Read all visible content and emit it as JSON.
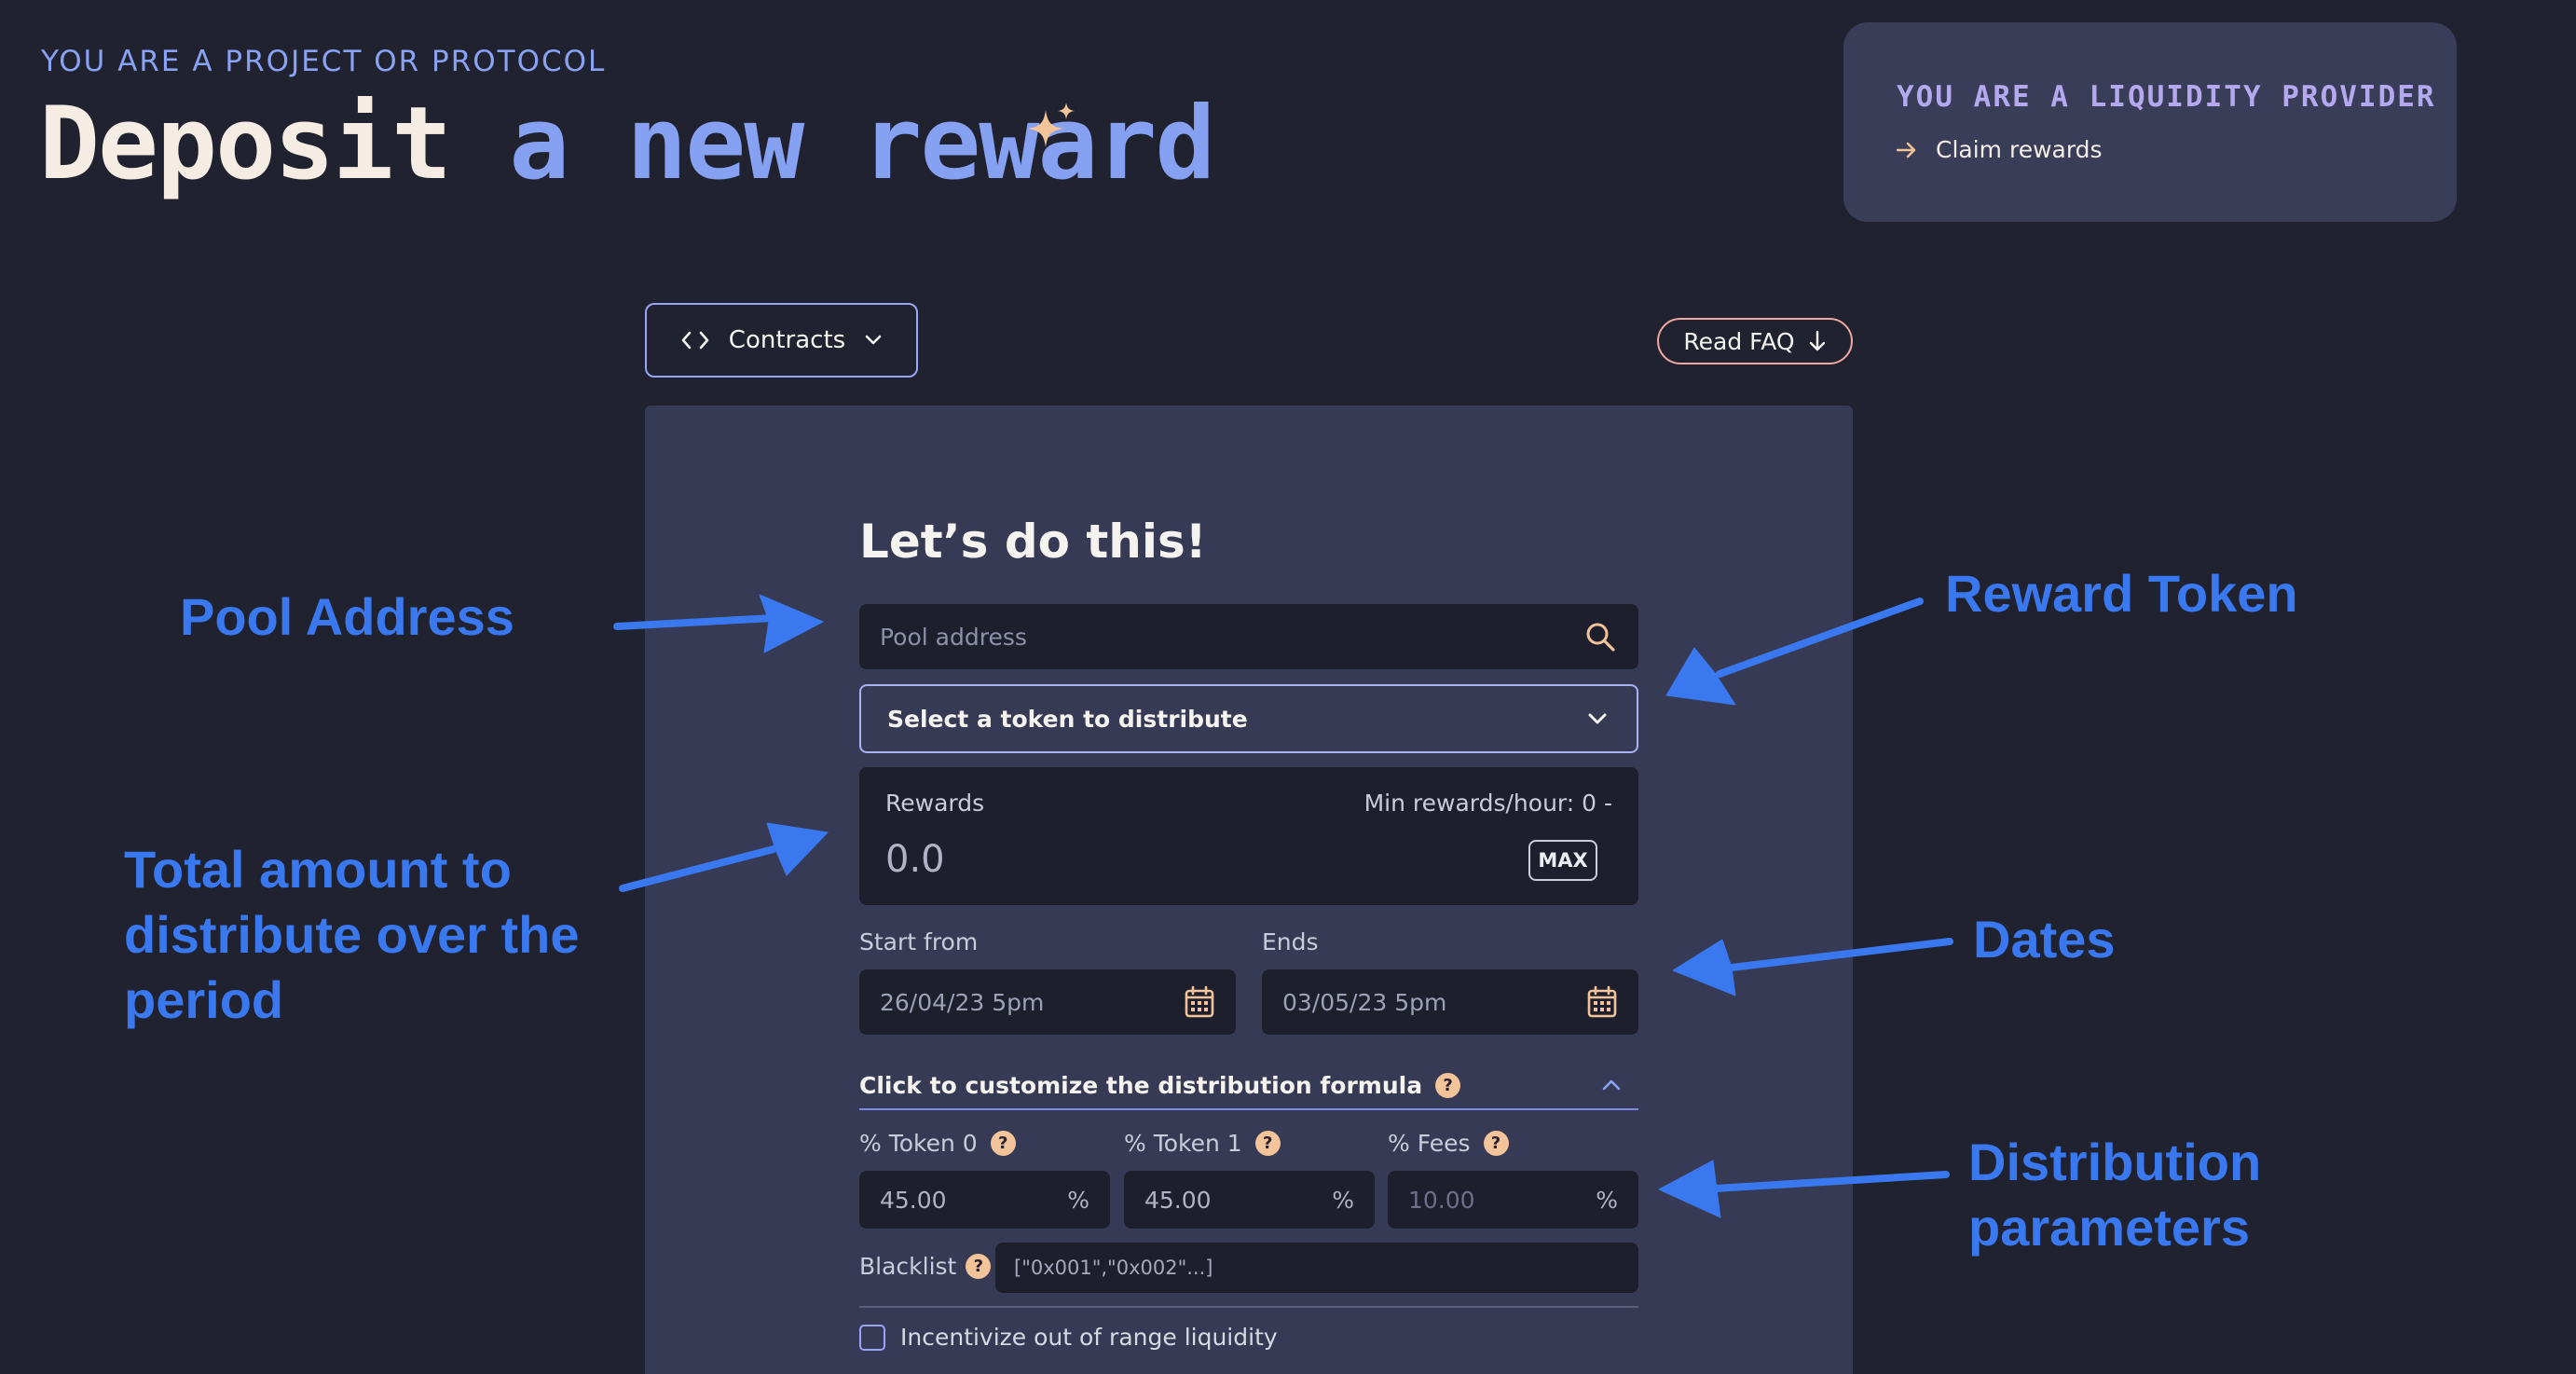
{
  "header": {
    "eyebrow": "YOU ARE A PROJECT OR PROTOCOL",
    "title_part1": "Deposit",
    "title_part2": "a new reward",
    "sparkle_icon": "sparkle-icon"
  },
  "lp_card": {
    "title": "YOU ARE A LIQUIDITY PROVIDER",
    "link": "Claim rewards"
  },
  "toolbar": {
    "contracts_label": "Contracts",
    "faq_label": "Read FAQ"
  },
  "form": {
    "title": "Let’s do this!",
    "pool_placeholder": "Pool address",
    "token_select": "Select a token to distribute",
    "rewards": {
      "label": "Rewards",
      "min_label": "Min rewards/hour: 0 -",
      "value": "0.0",
      "max_label": "MAX"
    },
    "start": {
      "label": "Start from",
      "value": "26/04/23 5pm"
    },
    "end": {
      "label": "Ends",
      "value": "03/05/23 5pm"
    },
    "customize_label": "Click to customize the distribution formula",
    "help_glyph": "?",
    "percent_symbol": "%",
    "token0": {
      "label": "% Token 0",
      "value": "45.00"
    },
    "token1": {
      "label": "% Token 1",
      "value": "45.00"
    },
    "fees": {
      "label": "% Fees",
      "value": "10.00"
    },
    "blacklist": {
      "label": "Blacklist",
      "placeholder": "[\"0x001\",\"0x002\"...]"
    },
    "out_of_range": "Incentivize out of range liquidity"
  },
  "annotations": {
    "pool_address": "Pool Address",
    "reward_token": "Reward Token",
    "total_amount_lines": [
      "Total amount to",
      "distribute over the",
      "period"
    ],
    "dates": "Dates",
    "distribution_lines": [
      "Distribution",
      "parameters"
    ]
  },
  "colors": {
    "background": "#20222f",
    "panel": "#363a54",
    "accent_blue": "#86a0f2",
    "annotation_blue": "#3a78f0",
    "accent_peach": "#f3c39a"
  }
}
